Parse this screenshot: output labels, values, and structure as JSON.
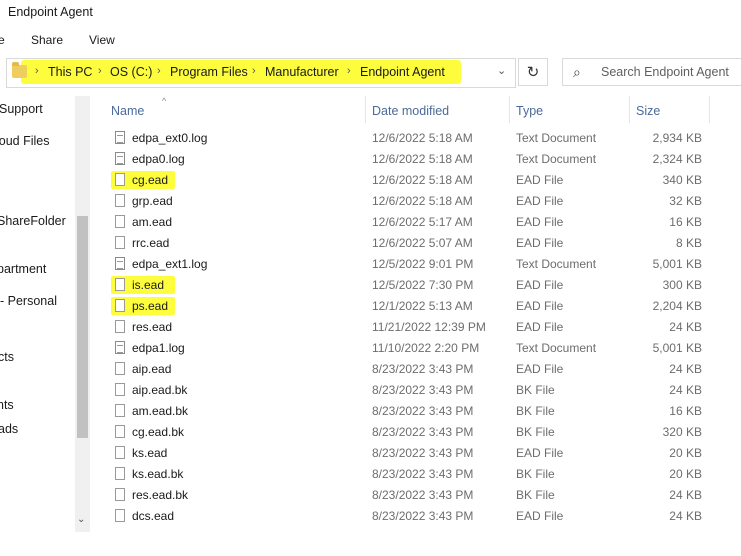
{
  "window": {
    "title": "Endpoint Agent"
  },
  "ribbon": {
    "tabs": [
      "e",
      "Share",
      "View"
    ]
  },
  "address": {
    "crumbs": [
      "This PC",
      "OS (C:)",
      "Program Files",
      "Manufacturer",
      "Endpoint Agent"
    ],
    "highlight_color": "#fdfd3e"
  },
  "search": {
    "placeholder": "Search Endpoint Agent"
  },
  "nav": {
    "items": [
      "Support",
      "loud Files",
      "ShareFolder",
      "partment",
      "- Personal",
      "cts",
      "nts",
      "ads"
    ]
  },
  "columns": {
    "name": "Name",
    "date": "Date modified",
    "type": "Type",
    "size": "Size"
  },
  "files": [
    {
      "name": "edpa_ext0.log",
      "date": "12/6/2022 5:18 AM",
      "type": "Text Document",
      "size": "2,934 KB",
      "icon": "txt",
      "highlight": false
    },
    {
      "name": "edpa0.log",
      "date": "12/6/2022 5:18 AM",
      "type": "Text Document",
      "size": "2,324 KB",
      "icon": "txt",
      "highlight": false
    },
    {
      "name": "cg.ead",
      "date": "12/6/2022 5:18 AM",
      "type": "EAD File",
      "size": "340 KB",
      "icon": "plain",
      "highlight": true
    },
    {
      "name": "grp.ead",
      "date": "12/6/2022 5:18 AM",
      "type": "EAD File",
      "size": "32 KB",
      "icon": "plain",
      "highlight": false
    },
    {
      "name": "am.ead",
      "date": "12/6/2022 5:17 AM",
      "type": "EAD File",
      "size": "16 KB",
      "icon": "plain",
      "highlight": false
    },
    {
      "name": "rrc.ead",
      "date": "12/6/2022 5:07 AM",
      "type": "EAD File",
      "size": "8 KB",
      "icon": "plain",
      "highlight": false
    },
    {
      "name": "edpa_ext1.log",
      "date": "12/5/2022 9:01 PM",
      "type": "Text Document",
      "size": "5,001 KB",
      "icon": "txt",
      "highlight": false
    },
    {
      "name": "is.ead",
      "date": "12/5/2022 7:30 PM",
      "type": "EAD File",
      "size": "300 KB",
      "icon": "plain",
      "highlight": true
    },
    {
      "name": "ps.ead",
      "date": "12/1/2022 5:13 AM",
      "type": "EAD File",
      "size": "2,204 KB",
      "icon": "plain",
      "highlight": true
    },
    {
      "name": "res.ead",
      "date": "11/21/2022 12:39 PM",
      "type": "EAD File",
      "size": "24 KB",
      "icon": "plain",
      "highlight": false
    },
    {
      "name": "edpa1.log",
      "date": "11/10/2022 2:20 PM",
      "type": "Text Document",
      "size": "5,001 KB",
      "icon": "txt",
      "highlight": false
    },
    {
      "name": "aip.ead",
      "date": "8/23/2022 3:43 PM",
      "type": "EAD File",
      "size": "24 KB",
      "icon": "plain",
      "highlight": false
    },
    {
      "name": "aip.ead.bk",
      "date": "8/23/2022 3:43 PM",
      "type": "BK File",
      "size": "24 KB",
      "icon": "plain",
      "highlight": false
    },
    {
      "name": "am.ead.bk",
      "date": "8/23/2022 3:43 PM",
      "type": "BK File",
      "size": "16 KB",
      "icon": "plain",
      "highlight": false
    },
    {
      "name": "cg.ead.bk",
      "date": "8/23/2022 3:43 PM",
      "type": "BK File",
      "size": "320 KB",
      "icon": "plain",
      "highlight": false
    },
    {
      "name": "ks.ead",
      "date": "8/23/2022 3:43 PM",
      "type": "EAD File",
      "size": "20 KB",
      "icon": "plain",
      "highlight": false
    },
    {
      "name": "ks.ead.bk",
      "date": "8/23/2022 3:43 PM",
      "type": "BK File",
      "size": "20 KB",
      "icon": "plain",
      "highlight": false
    },
    {
      "name": "res.ead.bk",
      "date": "8/23/2022 3:43 PM",
      "type": "BK File",
      "size": "24 KB",
      "icon": "plain",
      "highlight": false
    },
    {
      "name": "dcs.ead",
      "date": "8/23/2022 3:43 PM",
      "type": "EAD File",
      "size": "24 KB",
      "icon": "plain",
      "highlight": false
    }
  ]
}
